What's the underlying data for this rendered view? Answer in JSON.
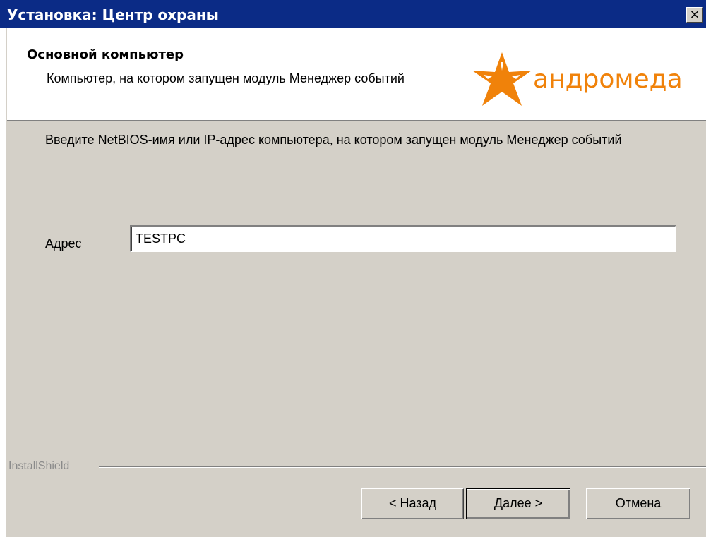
{
  "window": {
    "title": "Установка: Центр охраны",
    "close_symbol": "×"
  },
  "header": {
    "heading": "Основной компьютер",
    "subheading": "Компьютер, на котором запущен модуль Менеджер событий",
    "logo_text": "андромеда",
    "logo_icon": "star-icon",
    "logo_color": "#f0820a"
  },
  "body": {
    "instruction": "Введите NetBIOS-имя или IP-адрес компьютера, на котором запущен модуль Менеджер событий",
    "address_label": "Адрес",
    "address_value": "TESTPC"
  },
  "footer": {
    "brand": "InstallShield",
    "back_label": "< Назад",
    "next_label": "Далее >",
    "cancel_label": "Отмена"
  },
  "colors": {
    "titlebar": "#0b2b86",
    "panel": "#d4d0c8"
  }
}
